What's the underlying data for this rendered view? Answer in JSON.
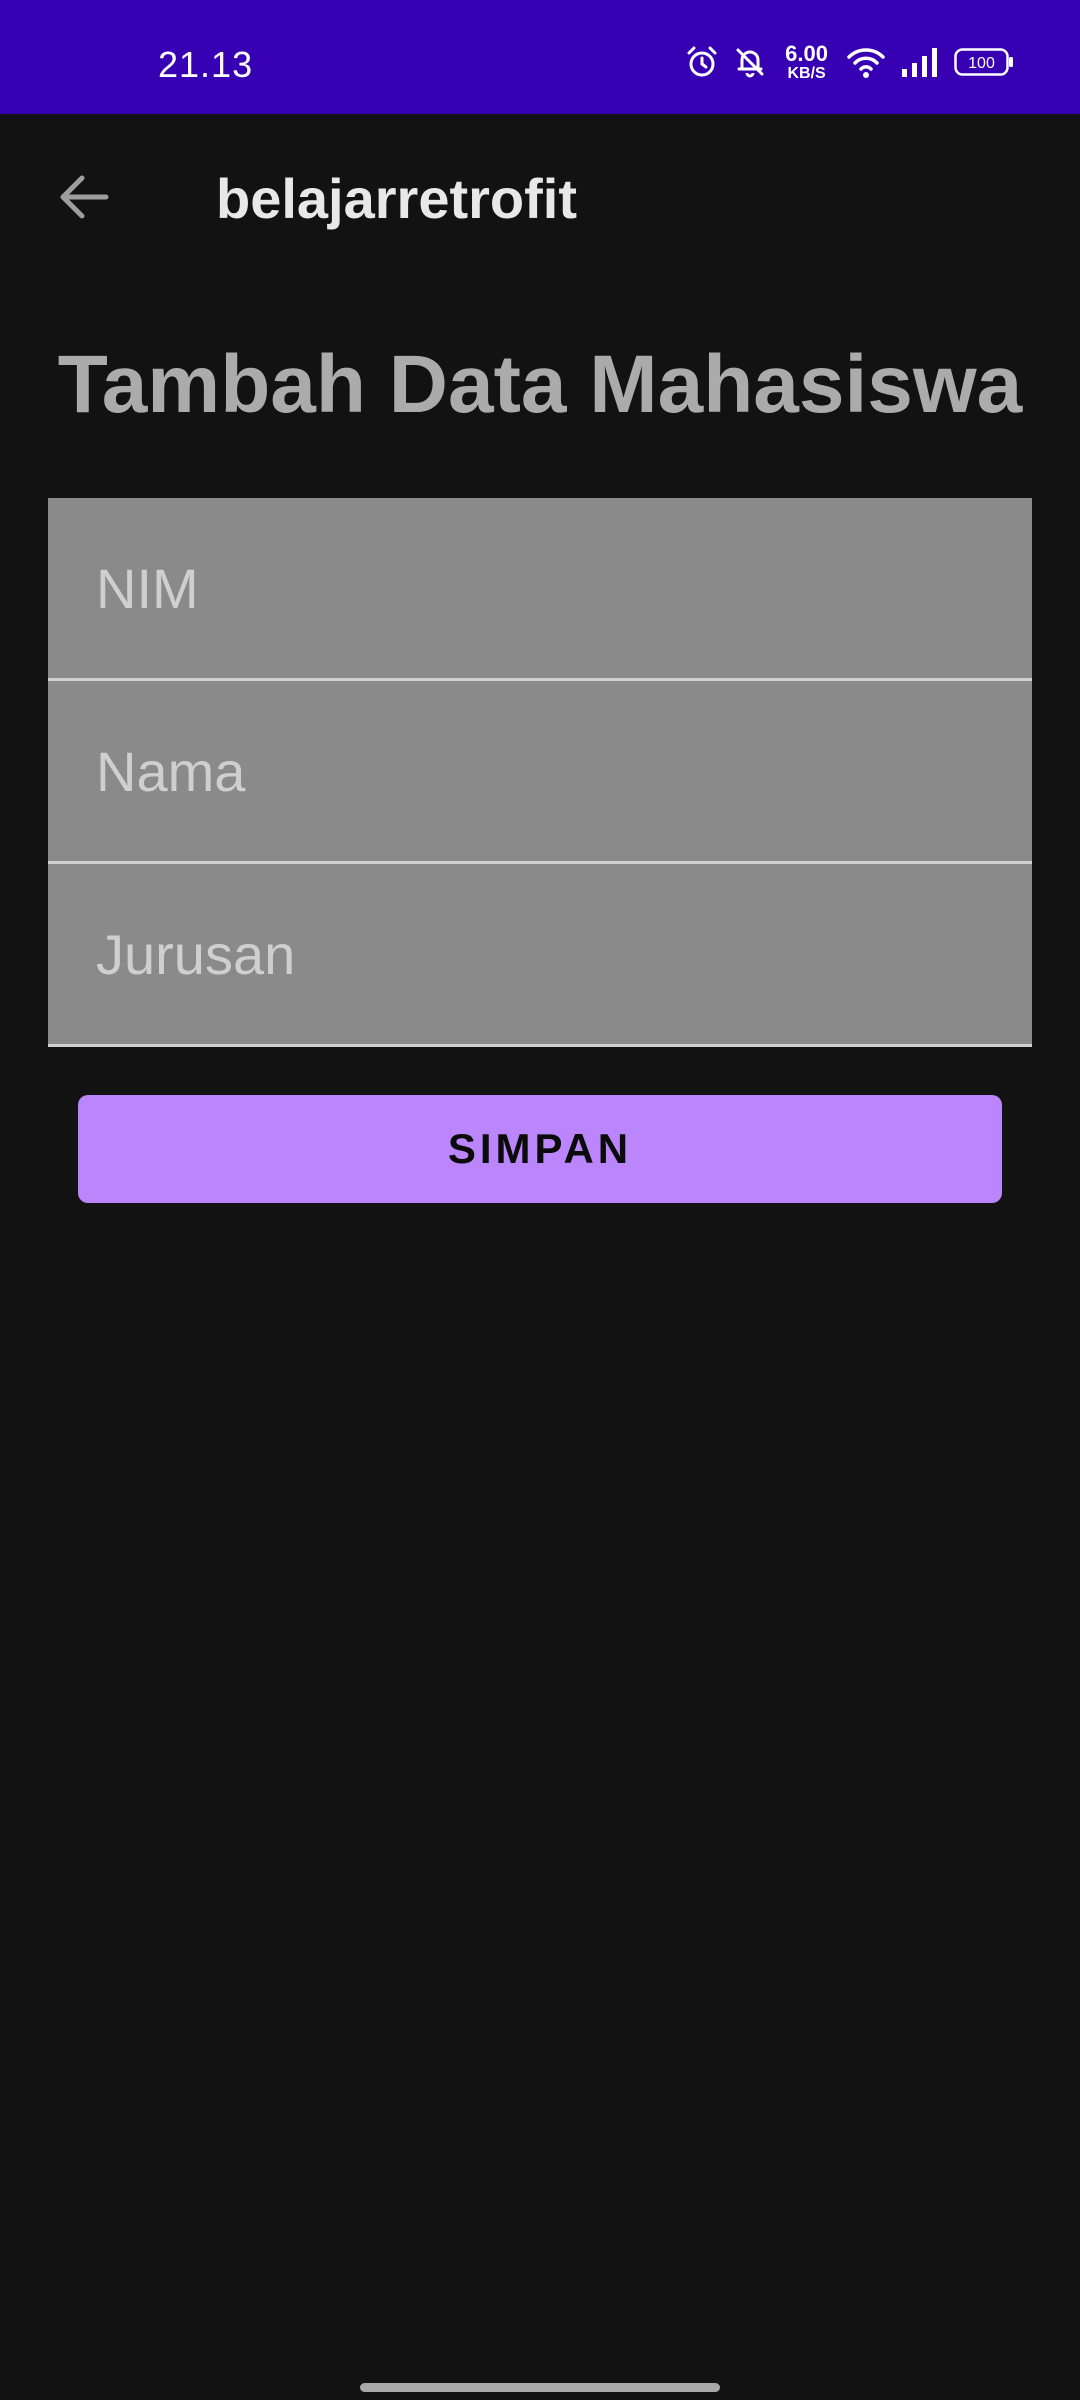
{
  "status_bar": {
    "time": "21.13",
    "net_speed_value": "6.00",
    "net_speed_unit": "KB/S",
    "battery": "100",
    "icons": [
      "alarm-icon",
      "notifications-off-icon",
      "wifi-icon",
      "signal-icon",
      "battery-icon"
    ],
    "background": "#3700b3"
  },
  "app_bar": {
    "title": "belajarretrofit",
    "back_icon": "arrow-back-icon"
  },
  "form": {
    "heading": "Tambah Data Mahasiswa",
    "fields": [
      {
        "placeholder": "NIM",
        "value": ""
      },
      {
        "placeholder": "Nama",
        "value": ""
      },
      {
        "placeholder": "Jurusan",
        "value": ""
      }
    ],
    "submit_label": "SIMPAN"
  },
  "colors": {
    "background": "#121212",
    "accent": "#bb86fc",
    "field_fill": "#8a8a8a"
  }
}
